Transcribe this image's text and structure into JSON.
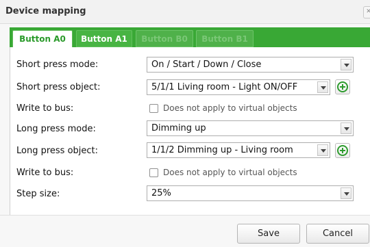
{
  "dialog": {
    "title": "Device mapping"
  },
  "tabs": [
    {
      "label": "Button A0",
      "state": "active"
    },
    {
      "label": "Button A1",
      "state": "normal"
    },
    {
      "label": "Button B0",
      "state": "disabled"
    },
    {
      "label": "Button B1",
      "state": "disabled"
    }
  ],
  "form": {
    "short_press_mode": {
      "label": "Short press mode:",
      "value": "On / Start / Down / Close"
    },
    "short_press_object": {
      "label": "Short press object:",
      "value": "5/1/1 Living room - Light ON/OFF"
    },
    "write_to_bus_1": {
      "label": "Write to bus:",
      "checkbox_label": "Does not apply to virtual objects",
      "checked": false
    },
    "long_press_mode": {
      "label": "Long press mode:",
      "value": "Dimming up"
    },
    "long_press_object": {
      "label": "Long press object:",
      "value": "1/1/2 Dimming up - Living room"
    },
    "write_to_bus_2": {
      "label": "Write to bus:",
      "checkbox_label": "Does not apply to virtual objects",
      "checked": false
    },
    "step_size": {
      "label": "Step size:",
      "value": "25%"
    }
  },
  "footer": {
    "save_label": "Save",
    "cancel_label": "Cancel"
  },
  "colors": {
    "accent": "#39a835",
    "active_tab_text": "#2a9a2a",
    "add_icon": "#2d9b2d"
  },
  "icons": {
    "add": "plus-circle-icon",
    "dropdown": "chevron-down-icon",
    "close": "close-icon"
  }
}
